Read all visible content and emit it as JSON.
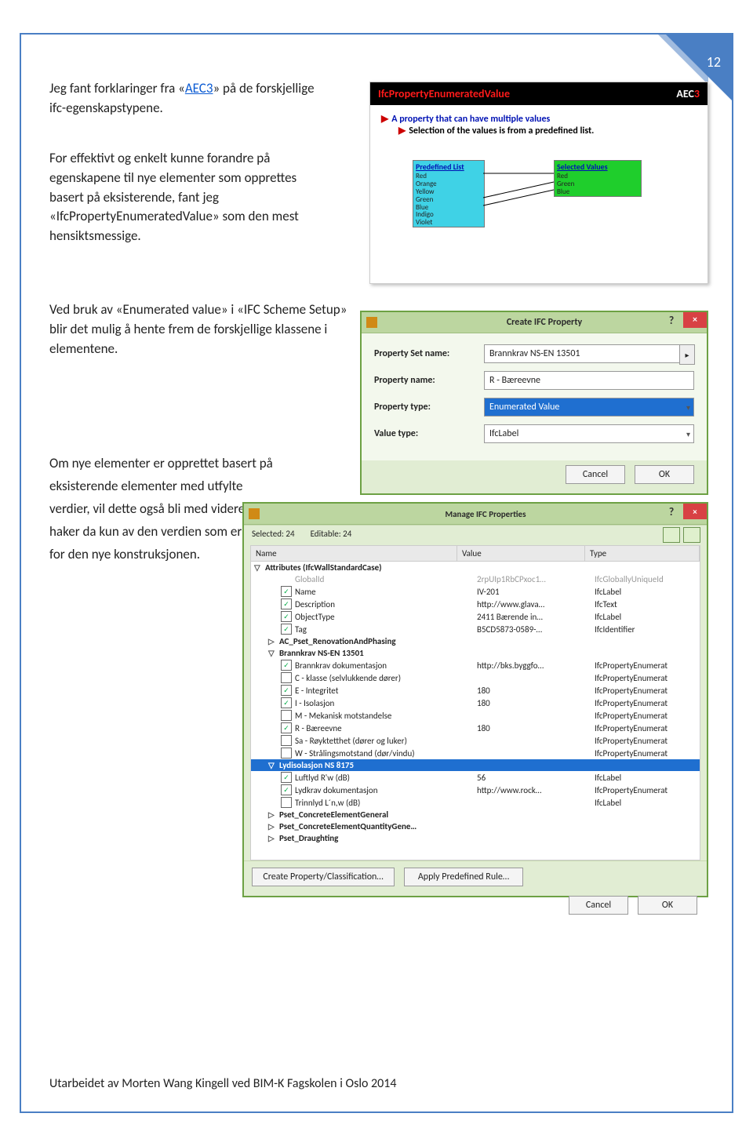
{
  "pageNumber": "12",
  "para1_a": "Jeg fant forklaringer fra «",
  "para1_link": "AEC3",
  "para1_b": "» på de forskjellige ifc-egenskapstypene.",
  "para2": "For effektivt og enkelt kunne forandre på egenskapene til nye elementer som opprettes basert på eksisterende, fant jeg «IfcPropertyEnumeratedValue» som den mest hensiktsmessige.",
  "para3": "Ved bruk av «Enumerated value» i «IFC Scheme Setup» blir det mulig å hente frem de forskjellige klassene i elementene.",
  "para4": "Om nye elementer er opprettet basert på eksisterende elementer med utfylte verdier, vil dette også bli med videre. Man haker da kun av den verdien som er rett for den nye konstruksjonen.",
  "footer": "Utarbeidet av Morten Wang Kingell ved BIM-K Fagskolen i Oslo 2014",
  "fig1": {
    "title": "IfcPropertyEnumeratedValue",
    "brand_pre": "AEC",
    "brand_suf": "3",
    "line1": "A property that can have multiple values",
    "line2": "Selection of the values is from a predefined list.",
    "preset_label": "Predefined List",
    "preset": [
      "Red",
      "Orange",
      "Yellow",
      "Green",
      "Blue",
      "Indigo",
      "Violet"
    ],
    "sel_label": "Selected Values",
    "sel": [
      "Red",
      "Green",
      "Blue"
    ]
  },
  "fig2": {
    "title": "Create IFC Property",
    "labels": {
      "set": "Property Set name:",
      "name": "Property name:",
      "type": "Property type:",
      "vtype": "Value type:"
    },
    "values": {
      "set": "Brannkrav NS-EN 13501",
      "name": "R - Bæreevne",
      "type": "Enumerated Value",
      "vtype": "IfcLabel"
    },
    "cancel": "Cancel",
    "ok": "OK"
  },
  "fig3": {
    "title": "Manage IFC Properties",
    "status_selected": "Selected: 24",
    "status_editable": "Editable: 24",
    "cols": {
      "name": "Name",
      "value": "Value",
      "type": "Type"
    },
    "group_attr": "Attributes (IfcWallStandardCase)",
    "rows_attr": [
      {
        "cb": false,
        "n": "GlobalId",
        "v": "2rpUIp1RbCPxoc1…",
        "t": "IfcGloballyUniqueId",
        "gray": true
      },
      {
        "cb": true,
        "checked": true,
        "n": "Name",
        "v": "IV-201",
        "t": "IfcLabel"
      },
      {
        "cb": true,
        "checked": true,
        "n": "Description",
        "v": "http://www.glava…",
        "t": "IfcText"
      },
      {
        "cb": true,
        "checked": true,
        "n": "ObjectType",
        "v": "2411 Bærende in…",
        "t": "IfcLabel"
      },
      {
        "cb": true,
        "checked": true,
        "n": "Tag",
        "v": "B5CD5873-0589-…",
        "t": "IfcIdentifier"
      }
    ],
    "group_pset1": "AC_Pset_RenovationAndPhasing",
    "group_brann": "Brannkrav NS-EN 13501",
    "rows_brann": [
      {
        "cb": true,
        "checked": true,
        "n": "Brannkrav dokumentasjon",
        "v": "http://bks.byggfo…",
        "t": "IfcPropertyEnumerat"
      },
      {
        "cb": true,
        "checked": false,
        "n": "C - klasse (selvlukkende dører)",
        "v": "",
        "t": "IfcPropertyEnumerat"
      },
      {
        "cb": true,
        "checked": true,
        "n": "E - Integritet",
        "v": "180",
        "t": "IfcPropertyEnumerat"
      },
      {
        "cb": true,
        "checked": true,
        "n": "I - Isolasjon",
        "v": "180",
        "t": "IfcPropertyEnumerat"
      },
      {
        "cb": true,
        "checked": false,
        "n": "M - Mekanisk motstandelse",
        "v": "",
        "t": "IfcPropertyEnumerat"
      },
      {
        "cb": true,
        "checked": true,
        "n": "R - Bæreevne",
        "v": "180",
        "t": "IfcPropertyEnumerat"
      },
      {
        "cb": true,
        "checked": false,
        "n": "Sa - Røyktetthet (dører og luker)",
        "v": "",
        "t": "IfcPropertyEnumerat"
      },
      {
        "cb": true,
        "checked": false,
        "n": "W - Strålingsmotstand (dør/vindu)",
        "v": "",
        "t": "IfcPropertyEnumerat"
      }
    ],
    "group_lyd": "Lydisolasjon NS 8175",
    "rows_lyd": [
      {
        "cb": true,
        "checked": true,
        "n": "Luftlyd R'w (dB)",
        "v": "56",
        "t": "IfcLabel"
      },
      {
        "cb": true,
        "checked": true,
        "n": "Lydkrav dokumentasjon",
        "v": "http://www.rock…",
        "t": "IfcPropertyEnumerat"
      },
      {
        "cb": true,
        "checked": false,
        "n": "Trinnlyd L´n,w (dB)",
        "v": "",
        "t": "IfcLabel"
      }
    ],
    "group_pc1": "Pset_ConcreteElementGeneral",
    "group_pc2": "Pset_ConcreteElementQuantityGene…",
    "group_pc3": "Pset_Draughting",
    "btn_create": "Create Property/Classification…",
    "btn_rule": "Apply Predefined Rule…",
    "cancel": "Cancel",
    "ok": "OK"
  }
}
